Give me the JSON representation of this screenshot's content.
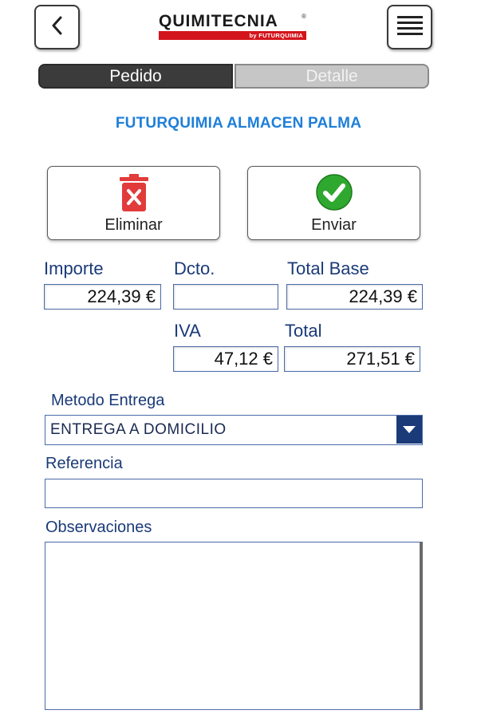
{
  "header": {
    "logo_text": "QUIMITECNIA",
    "logo_reg": "®",
    "logo_sub": "by FUTURQUIMIA",
    "back_icon": "chevron-left-icon",
    "menu_icon": "hamburger-menu-icon"
  },
  "tabs": [
    {
      "label": "Pedido",
      "active": true
    },
    {
      "label": "Detalle",
      "active": false
    }
  ],
  "client_name": "FUTURQUIMIA ALMACEN PALMA",
  "actions": {
    "delete_label": "Eliminar",
    "send_label": "Enviar"
  },
  "totals": {
    "importe_label": "Importe",
    "importe_value": "224,39 €",
    "dcto_label": "Dcto.",
    "dcto_value": "",
    "total_base_label": "Total Base",
    "total_base_value": "224,39 €",
    "iva_label": "IVA",
    "iva_value": "47,12 €",
    "total_label": "Total",
    "total_value": "271,51 €"
  },
  "form": {
    "metodo_label": "Metodo Entrega",
    "metodo_value": "ENTREGA A DOMICILIO",
    "referencia_label": "Referencia",
    "referencia_value": "",
    "observaciones_label": "Observaciones",
    "observaciones_value": ""
  },
  "colors": {
    "accent_blue": "#1e7fd8",
    "label_navy": "#1a3a78",
    "brand_red": "#d4141c",
    "delete_red": "#e23b3b",
    "send_green": "#2fa82f"
  }
}
